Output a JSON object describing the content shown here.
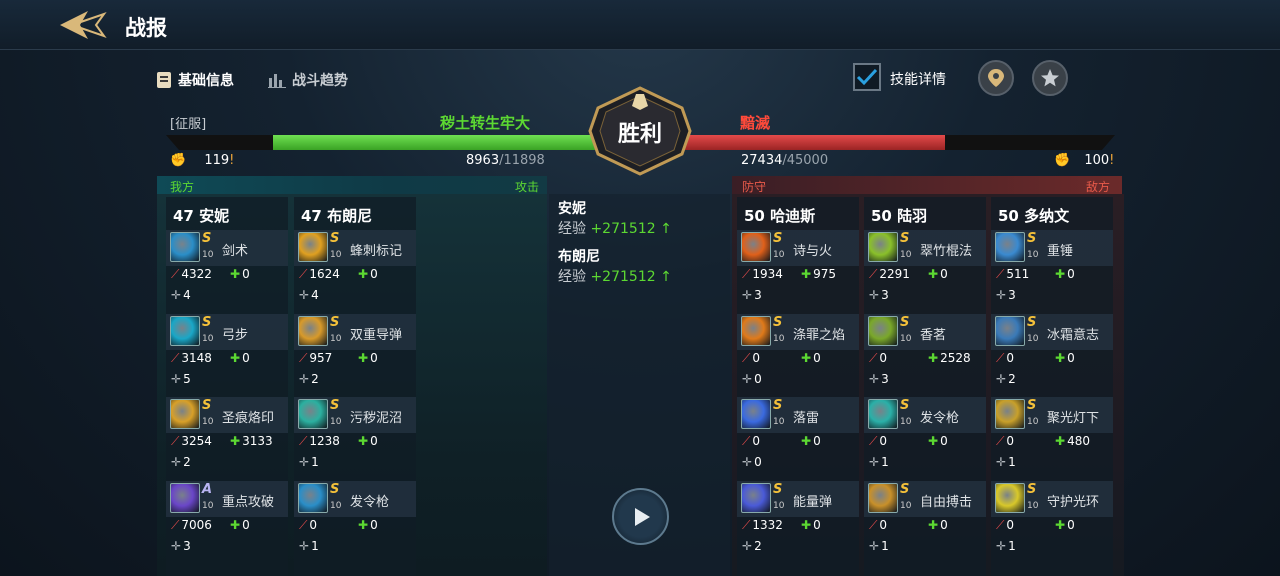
{
  "header": {
    "title": "战报"
  },
  "tabs": [
    {
      "label": "基础信息"
    },
    {
      "label": "战斗趋势"
    }
  ],
  "options": {
    "skill_detail_label": "技能详情",
    "skill_detail_checked": true
  },
  "battle": {
    "faction_tag": "[征服]",
    "result": "胜利",
    "left_team": "秽土转生牢大",
    "right_team": "黯滅",
    "left_power": "119",
    "right_power": "100",
    "left_hp": "8963",
    "left_hp_max": "/11898",
    "right_hp": "27434",
    "right_hp_max": "/45000",
    "left_side_label": "我方",
    "left_role_label": "攻击",
    "right_role_label": "防守",
    "right_side_label": "敌方"
  },
  "exp": [
    {
      "name": "安妮",
      "label": "经验",
      "value": "+271512"
    },
    {
      "name": "布朗尼",
      "label": "经验",
      "value": "+271512"
    }
  ],
  "heroes_left": [
    {
      "name": "47 安妮",
      "skills": [
        {
          "rank": "S",
          "level": "10",
          "name": "剑术",
          "damage": "4322",
          "heal": "0",
          "control": "4",
          "icon": "sword-skill-icon",
          "color": "#2a8ec8"
        },
        {
          "rank": "S",
          "level": "10",
          "name": "弓步",
          "damage": "3148",
          "heal": "0",
          "control": "5",
          "icon": "lunge-skill-icon",
          "color": "#1aa7c7"
        },
        {
          "rank": "S",
          "level": "10",
          "name": "圣痕烙印",
          "damage": "3254",
          "heal": "3133",
          "control": "2",
          "icon": "stigmata-skill-icon",
          "color": "#d8a028"
        },
        {
          "rank": "A",
          "level": "10",
          "name": "重点攻破",
          "damage": "7006",
          "heal": "0",
          "control": "3",
          "icon": "focus-break-skill-icon",
          "color": "#6a46c8"
        }
      ]
    },
    {
      "name": "47 布朗尼",
      "skills": [
        {
          "rank": "S",
          "level": "10",
          "name": "蜂刺标记",
          "damage": "1624",
          "heal": "0",
          "control": "4",
          "icon": "bee-sting-skill-icon",
          "color": "#e0a020"
        },
        {
          "rank": "S",
          "level": "10",
          "name": "双重导弹",
          "damage": "957",
          "heal": "0",
          "control": "2",
          "icon": "double-missile-skill-icon",
          "color": "#d89a2a"
        },
        {
          "rank": "S",
          "level": "10",
          "name": "污秽泥沼",
          "damage": "1238",
          "heal": "0",
          "control": "1",
          "icon": "mire-skill-icon",
          "color": "#2bb0a0"
        },
        {
          "rank": "S",
          "level": "10",
          "name": "发令枪",
          "damage": "0",
          "heal": "0",
          "control": "1",
          "icon": "starter-pistol-skill-icon",
          "color": "#2a8ec8"
        }
      ]
    }
  ],
  "heroes_right": [
    {
      "name": "50 哈迪斯",
      "skills": [
        {
          "rank": "S",
          "level": "10",
          "name": "诗与火",
          "damage": "1934",
          "heal": "975",
          "control": "3",
          "icon": "poem-fire-skill-icon",
          "color": "#e0601a"
        },
        {
          "rank": "S",
          "level": "10",
          "name": "涤罪之焰",
          "damage": "0",
          "heal": "0",
          "control": "0",
          "icon": "purge-flame-skill-icon",
          "color": "#e07a1a"
        },
        {
          "rank": "S",
          "level": "10",
          "name": "落雷",
          "damage": "0",
          "heal": "0",
          "control": "0",
          "icon": "thunder-skill-icon",
          "color": "#3a6ae0"
        },
        {
          "rank": "S",
          "level": "10",
          "name": "能量弹",
          "damage": "1332",
          "heal": "0",
          "control": "2",
          "icon": "energy-ball-skill-icon",
          "color": "#4a5ad8"
        }
      ]
    },
    {
      "name": "50 陆羽",
      "skills": [
        {
          "rank": "S",
          "level": "10",
          "name": "翠竹棍法",
          "damage": "2291",
          "heal": "0",
          "control": "3",
          "icon": "bamboo-staff-skill-icon",
          "color": "#8ac02a"
        },
        {
          "rank": "S",
          "level": "10",
          "name": "香茗",
          "damage": "0",
          "heal": "2528",
          "control": "3",
          "icon": "tea-skill-icon",
          "color": "#7aa82a"
        },
        {
          "rank": "S",
          "level": "10",
          "name": "发令枪",
          "damage": "0",
          "heal": "0",
          "control": "1",
          "icon": "starter-pistol-skill-icon",
          "color": "#2ab0a8"
        },
        {
          "rank": "S",
          "level": "10",
          "name": "自由搏击",
          "damage": "0",
          "heal": "0",
          "control": "1",
          "icon": "free-fight-skill-icon",
          "color": "#c8902a"
        }
      ]
    },
    {
      "name": "50 多纳文",
      "skills": [
        {
          "rank": "S",
          "level": "10",
          "name": "重锤",
          "damage": "511",
          "heal": "0",
          "control": "3",
          "icon": "hammer-skill-icon",
          "color": "#3a8ad0"
        },
        {
          "rank": "S",
          "level": "10",
          "name": "冰霜意志",
          "damage": "0",
          "heal": "0",
          "control": "2",
          "icon": "frost-will-skill-icon",
          "color": "#3a7ab8"
        },
        {
          "rank": "S",
          "level": "10",
          "name": "聚光灯下",
          "damage": "0",
          "heal": "480",
          "control": "1",
          "icon": "spotlight-skill-icon",
          "color": "#c8a02a"
        },
        {
          "rank": "S",
          "level": "10",
          "name": "守护光环",
          "damage": "0",
          "heal": "0",
          "control": "1",
          "icon": "guard-halo-skill-icon",
          "color": "#d8c82a"
        }
      ]
    }
  ]
}
